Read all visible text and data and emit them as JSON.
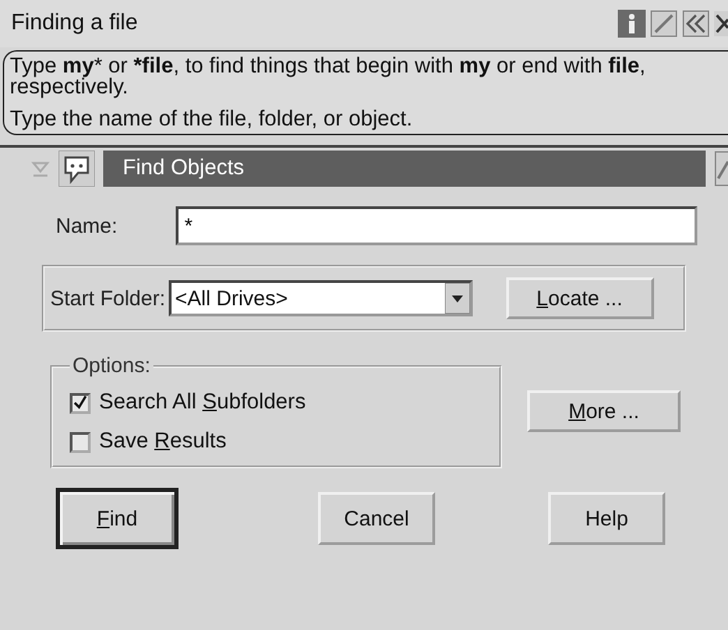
{
  "help_pane": {
    "title": "Finding a file",
    "hint_lines": [
      "Type **my*** or ***file**, to find things that begin with **my** or end with **file**,\nrespectively.",
      "Type the name of the file, folder, or object."
    ]
  },
  "dialog": {
    "title": "Find Objects",
    "name_field": {
      "label": "Name:",
      "value": "*"
    },
    "start_folder": {
      "label": "Start Folder:",
      "value": "<All Drives>",
      "button": {
        "key": "L",
        "after": "ocate ..."
      }
    },
    "options": {
      "legend": "Options:",
      "items": [
        {
          "before": "Search All ",
          "key": "S",
          "after": "ubfolders",
          "checked": true
        },
        {
          "before": "Save ",
          "key": "R",
          "after": "esults",
          "checked": false
        }
      ]
    },
    "more_button": {
      "key": "M",
      "after": "ore ..."
    },
    "buttons": [
      {
        "key": "F",
        "after": "ind",
        "default": true
      },
      {
        "before": "Cancel",
        "default": false
      },
      {
        "before": "Help",
        "default": false
      }
    ]
  }
}
